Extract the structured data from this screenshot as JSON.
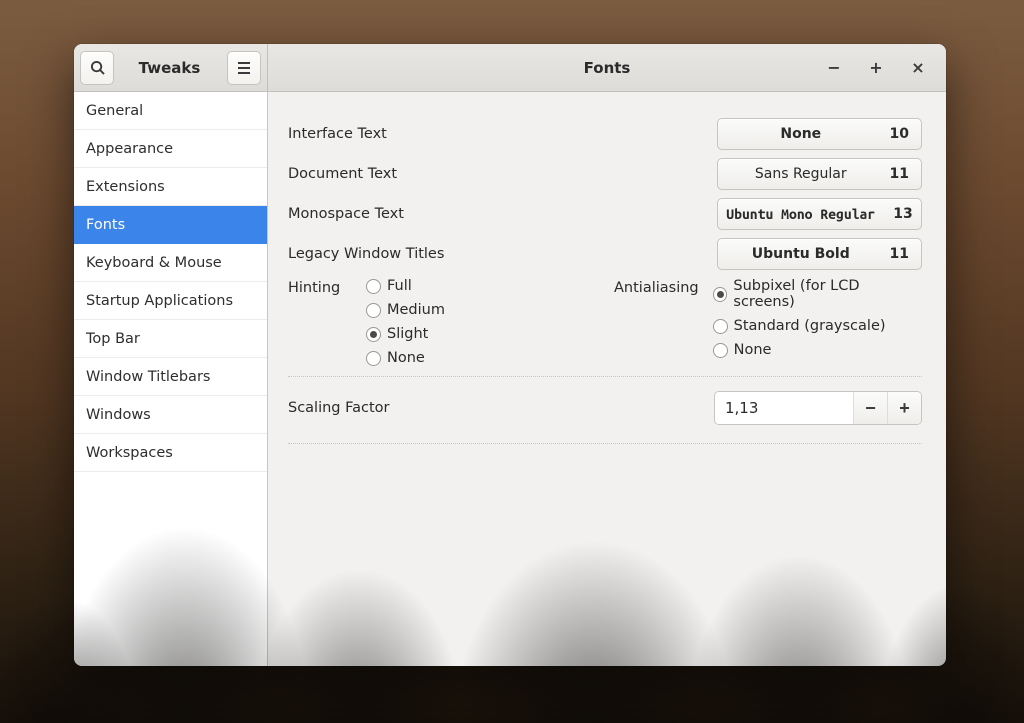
{
  "app": {
    "title": "Tweaks",
    "page_title": "Fonts"
  },
  "sidebar": {
    "items": [
      {
        "label": "General"
      },
      {
        "label": "Appearance"
      },
      {
        "label": "Extensions"
      },
      {
        "label": "Fonts"
      },
      {
        "label": "Keyboard & Mouse"
      },
      {
        "label": "Startup Applications"
      },
      {
        "label": "Top Bar"
      },
      {
        "label": "Window Titlebars"
      },
      {
        "label": "Windows"
      },
      {
        "label": "Workspaces"
      }
    ],
    "active_index": 3
  },
  "font_rows": [
    {
      "label": "Interface Text",
      "font_name": "None",
      "font_size": "10",
      "style": "bold"
    },
    {
      "label": "Document Text",
      "font_name": "Sans Regular",
      "font_size": "11",
      "style": "sans"
    },
    {
      "label": "Monospace Text",
      "font_name": "Ubuntu Mono Regular",
      "font_size": "13",
      "style": "mono"
    },
    {
      "label": "Legacy Window Titles",
      "font_name": "Ubuntu Bold",
      "font_size": "11",
      "style": "bold"
    }
  ],
  "hinting": {
    "label": "Hinting",
    "options": [
      "Full",
      "Medium",
      "Slight",
      "None"
    ],
    "checked_index": 2
  },
  "antialiasing": {
    "label": "Antialiasing",
    "options": [
      "Subpixel (for LCD screens)",
      "Standard (grayscale)",
      "None"
    ],
    "checked_index": 0
  },
  "scaling": {
    "label": "Scaling Factor",
    "value": "1,13"
  },
  "icons": {
    "search": "search-icon",
    "menu": "menu-icon",
    "minimize": "−",
    "maximize": "+",
    "close": "×",
    "spin_minus": "−",
    "spin_plus": "+"
  }
}
